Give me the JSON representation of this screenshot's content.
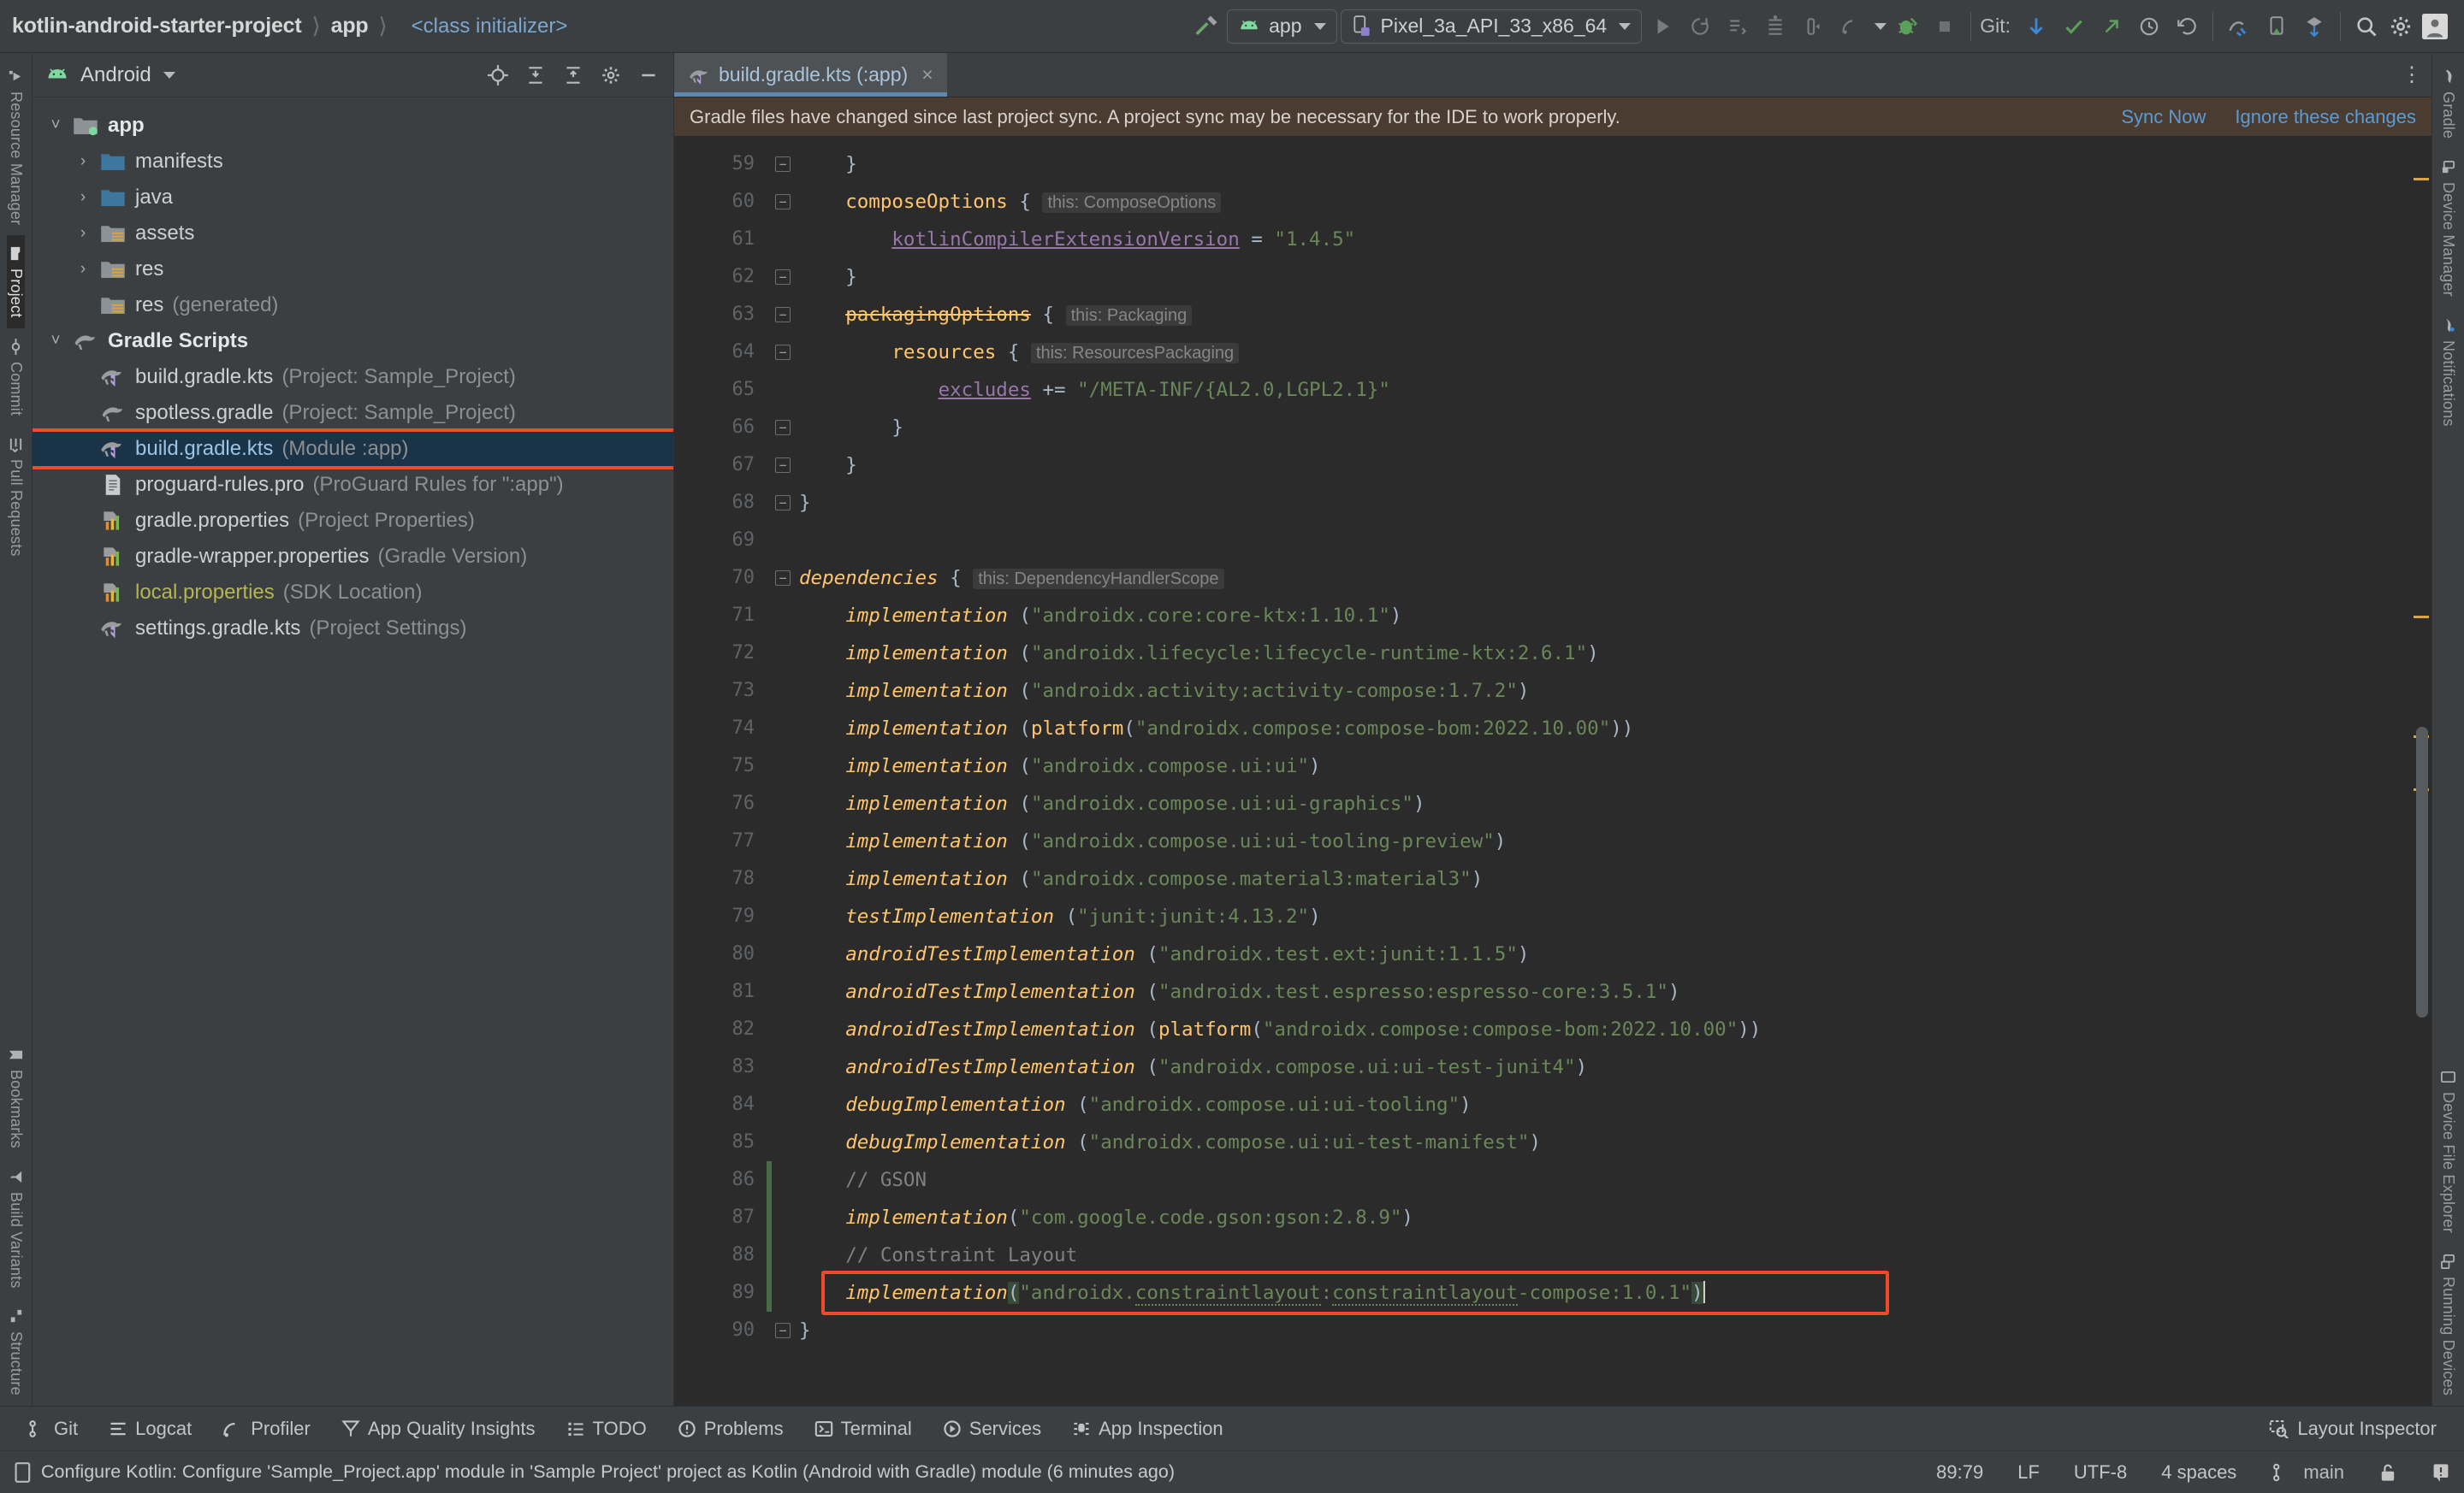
{
  "window": {
    "breadcrumbs": [
      {
        "label": "kotlin-android-starter-project",
        "style": "strong"
      },
      {
        "label": "app",
        "style": "strong"
      },
      {
        "label": "<class initializer>",
        "style": "link"
      }
    ]
  },
  "toolbar": {
    "run_config": {
      "label": "app",
      "icon": "android-robot-icon"
    },
    "device": {
      "label": "Pixel_3a_API_33_x86_64",
      "icon": "device-phone-icon"
    },
    "git_label": "Git:",
    "actions": [
      {
        "name": "hammer-build-icon"
      },
      {
        "name": "run-icon"
      },
      {
        "name": "rerun-icon"
      },
      {
        "name": "apply-changes-icon"
      },
      {
        "name": "apply-code-changes-icon"
      },
      {
        "name": "debug-icon"
      },
      {
        "name": "profile-icon"
      },
      {
        "name": "more-run-icon"
      },
      {
        "name": "attach-debugger-icon"
      },
      {
        "name": "stop-icon"
      },
      {
        "name": "git-update-icon"
      },
      {
        "name": "git-commit-icon"
      },
      {
        "name": "git-push-icon"
      },
      {
        "name": "git-history-icon"
      },
      {
        "name": "git-rollback-icon"
      },
      {
        "name": "device-explorer-icon"
      },
      {
        "name": "avd-manager-icon"
      },
      {
        "name": "sdk-manager-icon"
      },
      {
        "name": "search-everywhere-icon"
      },
      {
        "name": "settings-gear-icon"
      },
      {
        "name": "account-avatar-icon"
      }
    ]
  },
  "left_strip": {
    "top": [
      {
        "label": "Resource Manager",
        "icon": "resource-manager-icon",
        "active": false
      },
      {
        "label": "Project",
        "icon": "project-folder-icon",
        "active": true
      },
      {
        "label": "Commit",
        "icon": "commit-icon",
        "active": false
      },
      {
        "label": "Pull Requests",
        "icon": "pull-request-icon",
        "active": false
      }
    ],
    "bottom": [
      {
        "label": "Bookmarks",
        "icon": "bookmark-icon",
        "active": false
      },
      {
        "label": "Build Variants",
        "icon": "build-variants-icon",
        "active": false
      },
      {
        "label": "Structure",
        "icon": "structure-icon",
        "active": false
      }
    ]
  },
  "right_strip": {
    "top": [
      {
        "label": "Gradle",
        "icon": "gradle-elephant-icon"
      },
      {
        "label": "Device Manager",
        "icon": "device-manager-icon"
      },
      {
        "label": "Notifications",
        "icon": "notifications-icon"
      }
    ],
    "bottom": [
      {
        "label": "Device File Explorer",
        "icon": "device-file-explorer-icon"
      },
      {
        "label": "Running Devices",
        "icon": "running-devices-icon"
      }
    ]
  },
  "project_panel": {
    "title": "Android",
    "title_icon": "android-robot-icon",
    "header_actions": [
      {
        "name": "locate-target-icon"
      },
      {
        "name": "expand-all-icon"
      },
      {
        "name": "collapse-all-icon"
      },
      {
        "name": "settings-gear-icon"
      },
      {
        "name": "hide-panel-icon"
      }
    ],
    "tree": [
      {
        "depth": 0,
        "arrow": "down",
        "icon": "module-folder-icon",
        "name": "app",
        "suffix": "",
        "bold": true
      },
      {
        "depth": 1,
        "arrow": "right",
        "icon": "blue-folder-icon",
        "name": "manifests",
        "suffix": ""
      },
      {
        "depth": 1,
        "arrow": "right",
        "icon": "blue-folder-icon",
        "name": "java",
        "suffix": ""
      },
      {
        "depth": 1,
        "arrow": "right",
        "icon": "res-folder-icon",
        "name": "assets",
        "suffix": ""
      },
      {
        "depth": 1,
        "arrow": "right",
        "icon": "res-folder-icon",
        "name": "res",
        "suffix": ""
      },
      {
        "depth": 1,
        "arrow": "none",
        "icon": "res-folder-icon",
        "name": "res",
        "suffix": "(generated)"
      },
      {
        "depth": 0,
        "arrow": "down",
        "icon": "gradle-elephant-icon",
        "name": "Gradle Scripts",
        "suffix": "",
        "bold": true
      },
      {
        "depth": 1,
        "arrow": "none",
        "icon": "gradle-kts-icon",
        "name": "build.gradle.kts",
        "suffix": "(Project: Sample_Project)"
      },
      {
        "depth": 1,
        "arrow": "none",
        "icon": "gradle-icon",
        "name": "spotless.gradle",
        "suffix": "(Project: Sample_Project)"
      },
      {
        "depth": 1,
        "arrow": "none",
        "icon": "gradle-kts-icon",
        "name": "build.gradle.kts",
        "suffix": "(Module :app)",
        "selected": true,
        "highlighted": true
      },
      {
        "depth": 1,
        "arrow": "none",
        "icon": "text-file-icon",
        "name": "proguard-rules.pro",
        "suffix": "(ProGuard Rules for \":app\")"
      },
      {
        "depth": 1,
        "arrow": "none",
        "icon": "properties-icon",
        "name": "gradle.properties",
        "suffix": "(Project Properties)"
      },
      {
        "depth": 1,
        "arrow": "none",
        "icon": "properties-icon",
        "name": "gradle-wrapper.properties",
        "suffix": "(Gradle Version)"
      },
      {
        "depth": 1,
        "arrow": "none",
        "icon": "properties-icon",
        "name": "local.properties",
        "suffix": "(SDK Location)",
        "olive": true
      },
      {
        "depth": 1,
        "arrow": "none",
        "icon": "gradle-kts-icon",
        "name": "settings.gradle.kts",
        "suffix": "(Project Settings)"
      }
    ]
  },
  "editor": {
    "tab": {
      "label": "build.gradle.kts (:app)",
      "icon": "gradle-kts-icon",
      "close": "×"
    },
    "banner": {
      "message": "Gradle files have changed since last project sync. A project sync may be necessary for the IDE to work properly.",
      "sync_link": "Sync Now",
      "ignore_link": "Ignore these changes"
    },
    "first_line_number": 59,
    "lines": [
      {
        "n": 59,
        "fold": "minus",
        "html": "    <span class='punc'>}</span>"
      },
      {
        "n": 60,
        "fold": "minus",
        "html": "    <span class='fnn'>composeOptions</span> <span class='punc'>{</span> <span class='hint'>this: ComposeOptions</span>"
      },
      {
        "n": 61,
        "fold": "",
        "html": "        <span class='prop'>kotlinCompilerExtensionVersion</span> <span class='punc'>=</span> <span class='str'>\"1.4.5\"</span>"
      },
      {
        "n": 62,
        "fold": "minus",
        "html": "    <span class='punc'>}</span>"
      },
      {
        "n": 63,
        "fold": "minus",
        "html": "    <span class='fnn strike'>packagingOptions</span> <span class='punc'>{</span> <span class='hint'>this: Packaging</span>"
      },
      {
        "n": 64,
        "fold": "minus",
        "html": "        <span class='fnn'>resources</span> <span class='punc'>{</span> <span class='hint'>this: ResourcesPackaging</span>"
      },
      {
        "n": 65,
        "fold": "",
        "html": "            <span class='prop'>excludes</span> <span class='punc'>+=</span> <span class='str'>\"/META-INF/{AL2.0,LGPL2.1}\"</span>"
      },
      {
        "n": 66,
        "fold": "minus",
        "html": "        <span class='punc'>}</span>"
      },
      {
        "n": 67,
        "fold": "minus",
        "html": "    <span class='punc'>}</span>"
      },
      {
        "n": 68,
        "fold": "minus",
        "html": "<span class='punc'>}</span>"
      },
      {
        "n": 69,
        "fold": "",
        "html": ""
      },
      {
        "n": 70,
        "fold": "minus",
        "html": "<span class='fn'>dependencies</span> <span class='punc'>{</span> <span class='hint'>this: DependencyHandlerScope</span>"
      },
      {
        "n": 71,
        "fold": "",
        "html": "    <span class='fn'>implementation</span> <span class='punc'>(</span><span class='str'>\"androidx.core:core-ktx:1.10.1\"</span><span class='punc'>)</span>"
      },
      {
        "n": 72,
        "fold": "",
        "html": "    <span class='fn'>implementation</span> <span class='punc'>(</span><span class='str'>\"androidx.lifecycle:lifecycle-runtime-ktx:2.6.1\"</span><span class='punc'>)</span>"
      },
      {
        "n": 73,
        "fold": "",
        "html": "    <span class='fn'>implementation</span> <span class='punc'>(</span><span class='str'>\"androidx.activity:activity-compose:1.7.2\"</span><span class='punc'>)</span>"
      },
      {
        "n": 74,
        "fold": "",
        "html": "    <span class='fn'>implementation</span> <span class='punc'>(</span><span class='fnn'>platform</span><span class='punc'>(</span><span class='str'>\"androidx.compose:compose-bom:2022.10.00\"</span><span class='punc'>))</span>"
      },
      {
        "n": 75,
        "fold": "",
        "html": "    <span class='fn'>implementation</span> <span class='punc'>(</span><span class='str'>\"androidx.compose.ui:ui\"</span><span class='punc'>)</span>"
      },
      {
        "n": 76,
        "fold": "",
        "html": "    <span class='fn'>implementation</span> <span class='punc'>(</span><span class='str'>\"androidx.compose.ui:ui-graphics\"</span><span class='punc'>)</span>"
      },
      {
        "n": 77,
        "fold": "",
        "html": "    <span class='fn'>implementation</span> <span class='punc'>(</span><span class='str'>\"androidx.compose.ui:ui-tooling-preview\"</span><span class='punc'>)</span>"
      },
      {
        "n": 78,
        "fold": "",
        "html": "    <span class='fn'>implementation</span> <span class='punc'>(</span><span class='str'>\"androidx.compose.material3:material3\"</span><span class='punc'>)</span>"
      },
      {
        "n": 79,
        "fold": "",
        "html": "    <span class='fn'>testImplementation</span> <span class='punc'>(</span><span class='str'>\"junit:junit:4.13.2\"</span><span class='punc'>)</span>"
      },
      {
        "n": 80,
        "fold": "",
        "html": "    <span class='fn'>androidTestImplementation</span> <span class='punc'>(</span><span class='str'>\"androidx.test.ext:junit:1.1.5\"</span><span class='punc'>)</span>"
      },
      {
        "n": 81,
        "fold": "",
        "html": "    <span class='fn'>androidTestImplementation</span> <span class='punc'>(</span><span class='str'>\"androidx.test.espresso:espresso-core:3.5.1\"</span><span class='punc'>)</span>"
      },
      {
        "n": 82,
        "fold": "",
        "html": "    <span class='fn'>androidTestImplementation</span> <span class='punc'>(</span><span class='fnn'>platform</span><span class='punc'>(</span><span class='str'>\"androidx.compose:compose-bom:2022.10.00\"</span><span class='punc'>))</span>"
      },
      {
        "n": 83,
        "fold": "",
        "html": "    <span class='fn'>androidTestImplementation</span> <span class='punc'>(</span><span class='str'>\"androidx.compose.ui:ui-test-junit4\"</span><span class='punc'>)</span>"
      },
      {
        "n": 84,
        "fold": "",
        "html": "    <span class='fn'>debugImplementation</span> <span class='punc'>(</span><span class='str'>\"androidx.compose.ui:ui-tooling\"</span><span class='punc'>)</span>"
      },
      {
        "n": 85,
        "fold": "",
        "html": "    <span class='fn'>debugImplementation</span> <span class='punc'>(</span><span class='str'>\"androidx.compose.ui:ui-test-manifest\"</span><span class='punc'>)</span>"
      },
      {
        "n": 86,
        "fold": "",
        "changed": true,
        "html": "    <span class='cmt'>// GSON</span>"
      },
      {
        "n": 87,
        "fold": "",
        "changed": true,
        "html": "    <span class='fn'>implementation</span><span class='punc'>(</span><span class='str'>\"com.google.code.gson:gson:2.8.9\"</span><span class='punc'>)</span>"
      },
      {
        "n": 88,
        "fold": "",
        "changed": true,
        "html": "    <span class='cmt'>// Constraint Layout</span>"
      },
      {
        "n": 89,
        "fold": "",
        "changed": true,
        "highlighted": true,
        "html": "    <span class='fn'>implementation</span><span class='punc brk'>(</span><span class='str'>\"androidx.</span><span class='str wavy'>constraintlayout</span><span class='str'>:</span><span class='str wavy'>constraintlayout</span><span class='str'>-compose:1.0.1\"</span><span class='punc brk'>)</span><span class='caretbar'></span>"
      },
      {
        "n": 90,
        "fold": "minus",
        "html": "<span class='punc'>}</span>"
      }
    ]
  },
  "bottom_tabs": [
    {
      "label": "Git",
      "icon": "git-branch-icon"
    },
    {
      "label": "Logcat",
      "icon": "logcat-icon"
    },
    {
      "label": "Profiler",
      "icon": "profiler-icon"
    },
    {
      "label": "App Quality Insights",
      "icon": "app-quality-insights-icon"
    },
    {
      "label": "TODO",
      "icon": "todo-icon"
    },
    {
      "label": "Problems",
      "icon": "problems-icon"
    },
    {
      "label": "Terminal",
      "icon": "terminal-icon"
    },
    {
      "label": "Services",
      "icon": "services-icon"
    },
    {
      "label": "App Inspection",
      "icon": "app-inspection-icon"
    }
  ],
  "bottom_right_tab": {
    "label": "Layout Inspector",
    "icon": "layout-inspector-icon"
  },
  "status_bar": {
    "message": "Configure Kotlin: Configure 'Sample_Project.app' module in 'Sample Project' project as Kotlin (Android with Gradle) module (6 minutes ago)",
    "caret_position": "89:79",
    "line_separator": "LF",
    "encoding": "UTF-8",
    "indent": "4 spaces",
    "branch": "main",
    "branch_icon": "git-branch-icon",
    "lock_icon": "unlocked-icon",
    "inspection_icon": "inspection-status-icon"
  },
  "colors": {
    "accent_blue": "#5b9bd5",
    "highlight_red": "#ef4b2a",
    "selection_blue": "#1b3347",
    "banner_bg": "#4a3c31",
    "editor_bg": "#2b2b2b",
    "panel_bg": "#3c3f41",
    "green": "#6a8759",
    "orange": "#cc7832",
    "yellow": "#ffc66d",
    "purple": "#9876aa"
  }
}
